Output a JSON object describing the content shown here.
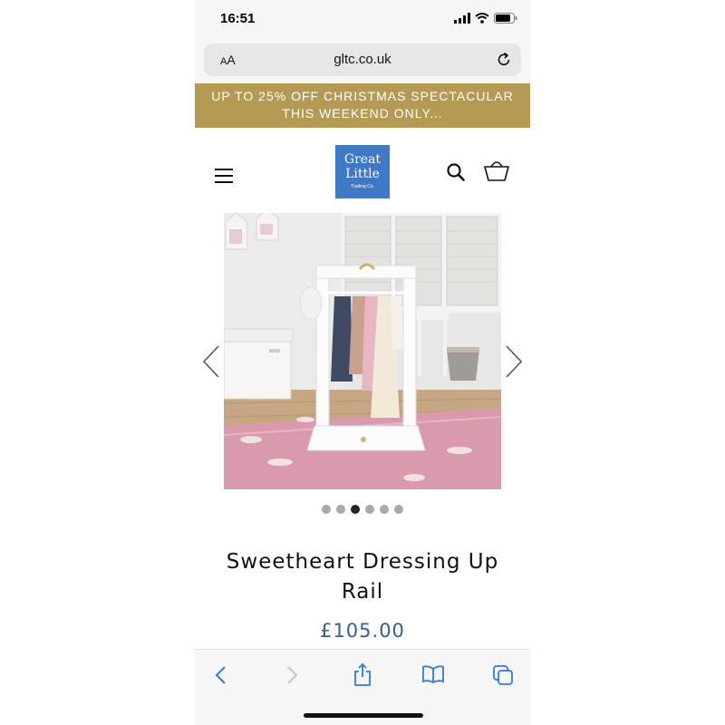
{
  "status_bar": {
    "time": "16:51"
  },
  "browser": {
    "aa_label_big": "A",
    "aa_label_small": "A",
    "url": "gltc.co.uk"
  },
  "promo": {
    "line1": "UP TO 25% OFF CHRISTMAS SPECTACULAR",
    "line2": "THIS WEEKEND ONLY..."
  },
  "logo": {
    "line1": "Great",
    "line2": "Little",
    "line3": "Trading Co."
  },
  "carousel": {
    "total": 6,
    "active_index": 2
  },
  "product": {
    "title": "Sweetheart Dressing Up Rail",
    "price": "£105.00"
  },
  "colors": {
    "promo_bg": "#b49a53",
    "logo_bg": "#3f78c4",
    "price": "#3a5f82",
    "toolbar_icon": "#2f7ae5"
  },
  "icons": [
    "signal-icon",
    "wifi-icon",
    "battery-icon",
    "reload-icon",
    "menu-icon",
    "search-icon",
    "bag-icon",
    "chevron-left-icon",
    "chevron-right-icon",
    "back-icon",
    "forward-icon",
    "share-icon",
    "bookmarks-icon",
    "tabs-icon"
  ]
}
